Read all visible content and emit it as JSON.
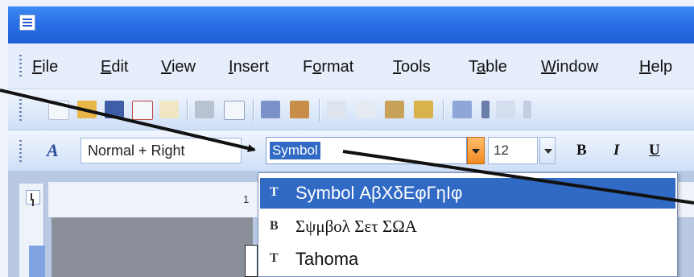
{
  "menubar": {
    "items": [
      {
        "pre": "",
        "acc": "F",
        "post": "ile"
      },
      {
        "pre": "",
        "acc": "E",
        "post": "dit"
      },
      {
        "pre": "",
        "acc": "V",
        "post": "iew"
      },
      {
        "pre": "",
        "acc": "I",
        "post": "nsert"
      },
      {
        "pre": "F",
        "acc": "o",
        "post": "rmat"
      },
      {
        "pre": "",
        "acc": "T",
        "post": "ools"
      },
      {
        "pre": "T",
        "acc": "a",
        "post": "ble"
      },
      {
        "pre": "",
        "acc": "W",
        "post": "indow"
      },
      {
        "pre": "",
        "acc": "H",
        "post": "elp"
      }
    ]
  },
  "formatting": {
    "style_value": "Normal + Right",
    "font_value": "Symbol",
    "size_value": "12",
    "bold_label": "B",
    "italic_label": "I",
    "underline_label": "U"
  },
  "ruler": {
    "marker": "1"
  },
  "font_list": {
    "items": [
      {
        "icon": "T",
        "name": "Symbol ΑβΧδΕφΓηΙφ",
        "selected": true
      },
      {
        "icon": "B",
        "name": "Σψμβολ Σετ ΣΩΑ",
        "selected": false
      },
      {
        "icon": "T",
        "name": "Tahoma",
        "selected": false
      }
    ]
  },
  "colors": {
    "titlebar": "#2a6fe6",
    "selection": "#316ac5",
    "dropdown_button": "#f08a22",
    "arrow": "#111111"
  }
}
